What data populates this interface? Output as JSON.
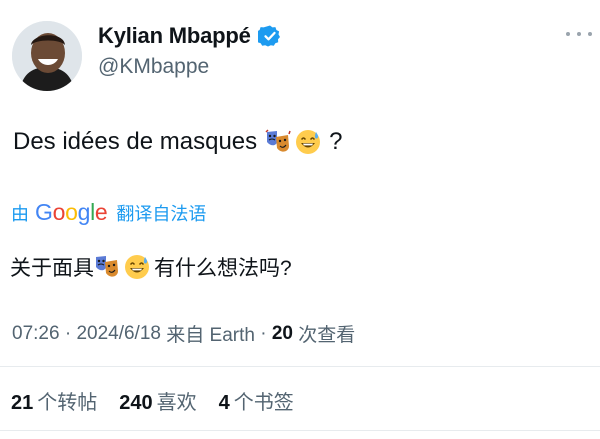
{
  "author": {
    "name": "Kylian Mbappé",
    "handle": "@KMbappe"
  },
  "tweet": {
    "text_before": "Des idées de masques",
    "text_after": "?",
    "emojis": [
      "performing-arts-icon",
      "grinning-sweat-icon"
    ]
  },
  "translation": {
    "prefix": "由",
    "provider_letters": [
      "G",
      "o",
      "o",
      "g",
      "l",
      "e"
    ],
    "suffix": "翻译自法语",
    "text_before": "关于面具",
    "text_after": "有什么想法吗?"
  },
  "meta": {
    "time": "07:26",
    "sep1": " · ",
    "date": "2024/6/18",
    "source": " 来自 Earth",
    "sep2": " · ",
    "views_count": "20",
    "views_label": " 次查看"
  },
  "stats": {
    "retweets_count": "21",
    "retweets_label": "个转帖",
    "likes_count": "240",
    "likes_label": "喜欢",
    "bookmarks_count": "4",
    "bookmarks_label": "个书签"
  },
  "colors": {
    "accent": "#1d9bf0",
    "secondary_text": "#536471",
    "primary_text": "#0f1419"
  }
}
